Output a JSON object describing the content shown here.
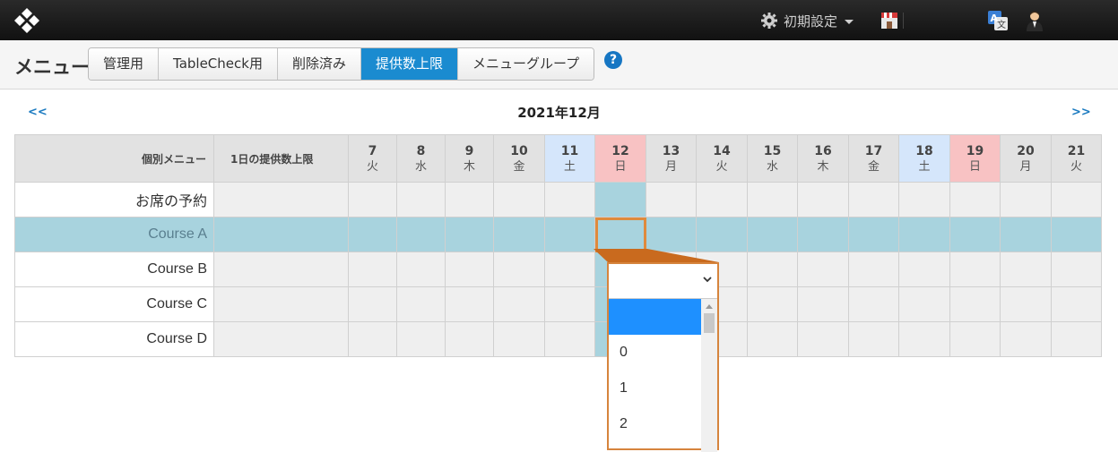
{
  "topbar": {
    "settings_label": "初期設定"
  },
  "subbar": {
    "page_title": "メニュー",
    "tabs": [
      {
        "label": "管理用",
        "active": false
      },
      {
        "label": "TableCheck用",
        "active": false
      },
      {
        "label": "削除済み",
        "active": false
      },
      {
        "label": "提供数上限",
        "active": true
      },
      {
        "label": "メニューグループ",
        "active": false
      }
    ],
    "help": "?"
  },
  "calendar": {
    "prev": "<<",
    "next": ">>",
    "month": "2021年12月",
    "header_menu": "個別メニュー",
    "header_limit": "1日の提供数上限",
    "days": [
      {
        "num": "7",
        "wd": "火",
        "kind": "weekday"
      },
      {
        "num": "8",
        "wd": "水",
        "kind": "weekday"
      },
      {
        "num": "9",
        "wd": "木",
        "kind": "weekday"
      },
      {
        "num": "10",
        "wd": "金",
        "kind": "weekday"
      },
      {
        "num": "11",
        "wd": "土",
        "kind": "sat"
      },
      {
        "num": "12",
        "wd": "日",
        "kind": "sun"
      },
      {
        "num": "13",
        "wd": "月",
        "kind": "weekday"
      },
      {
        "num": "14",
        "wd": "火",
        "kind": "weekday"
      },
      {
        "num": "15",
        "wd": "水",
        "kind": "weekday"
      },
      {
        "num": "16",
        "wd": "木",
        "kind": "weekday"
      },
      {
        "num": "17",
        "wd": "金",
        "kind": "weekday"
      },
      {
        "num": "18",
        "wd": "土",
        "kind": "sat"
      },
      {
        "num": "19",
        "wd": "日",
        "kind": "sun"
      },
      {
        "num": "20",
        "wd": "月",
        "kind": "weekday"
      },
      {
        "num": "21",
        "wd": "火",
        "kind": "weekday"
      }
    ],
    "rows": [
      {
        "name": "お席の予約"
      },
      {
        "name": "Course A"
      },
      {
        "name": "Course B"
      },
      {
        "name": "Course C"
      },
      {
        "name": "Course D"
      }
    ]
  },
  "dropdown": {
    "selected": "",
    "options": [
      "",
      "0",
      "1",
      "2"
    ]
  },
  "colors": {
    "accent": "#1a8bd0",
    "highlight_row": "#a8d3de",
    "selected_outline": "#df8a3d",
    "saturday": "#d5e6fb",
    "sunday": "#f8c2c3"
  }
}
